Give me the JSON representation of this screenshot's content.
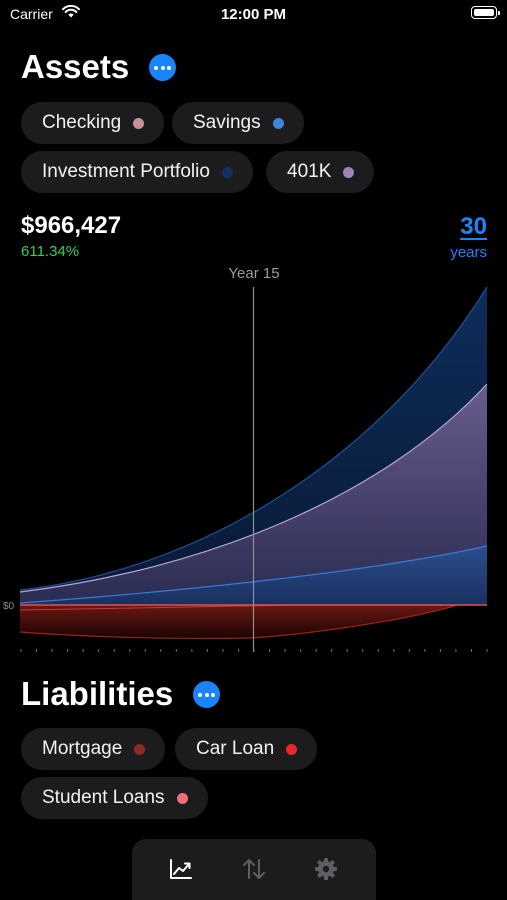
{
  "status_bar": {
    "carrier": "Carrier",
    "time": "12:00 PM"
  },
  "assets": {
    "title": "Assets",
    "chips": [
      {
        "label": "Checking",
        "color": "#c98f97"
      },
      {
        "label": "Savings",
        "color": "#3d86d8"
      },
      {
        "label": "Investment Portfolio",
        "color": "#12305e"
      },
      {
        "label": "401K",
        "color": "#9d84b6"
      }
    ],
    "total": "$966,427",
    "growth": "611.34%",
    "years_value": "30",
    "years_label": "years"
  },
  "chart_data": {
    "type": "area",
    "selected_label": "Year 15",
    "y_tick_label": "$0",
    "x_range": [
      0,
      30
    ],
    "x_ticks": 31,
    "selected_x": 15,
    "series_colors": {
      "investment": "#0b2a55",
      "k401": "#6e5f91",
      "savings": "#2b4f8e",
      "liabilities": "#a1241c",
      "zero_line": "#e3504b"
    }
  },
  "liabilities": {
    "title": "Liabilities",
    "chips": [
      {
        "label": "Mortgage",
        "color": "#8b2b24"
      },
      {
        "label": "Car Loan",
        "color": "#e8262b"
      },
      {
        "label": "Student Loans",
        "color": "#ef6f78"
      }
    ]
  },
  "tabbar": {
    "tabs": [
      {
        "icon": "chart-icon",
        "active": true
      },
      {
        "icon": "transfer-arrows-icon",
        "active": false
      },
      {
        "icon": "gear-icon",
        "active": false
      }
    ]
  }
}
